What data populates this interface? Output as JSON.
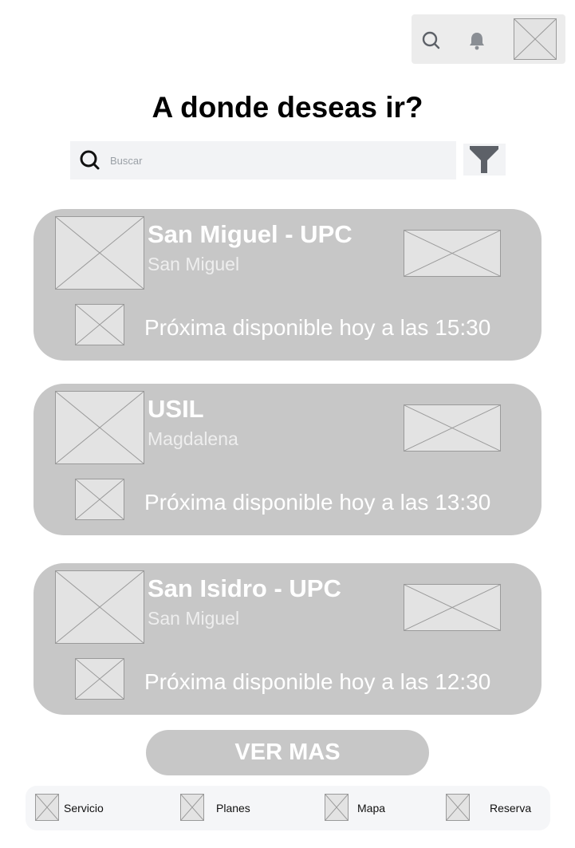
{
  "header": {
    "title": "A donde deseas ir?",
    "icons": [
      "search-icon",
      "bell-icon"
    ]
  },
  "search": {
    "placeholder": "Buscar",
    "value": ""
  },
  "cards": [
    {
      "name": "San Miguel - UPC",
      "location": "San Miguel",
      "next": "Próxima disponible hoy a las 15:30"
    },
    {
      "name": "USIL",
      "location": "Magdalena",
      "next": "Próxima disponible hoy a las 13:30"
    },
    {
      "name": "San Isidro - UPC",
      "location": "San Miguel",
      "next": "Próxima disponible hoy a las 12:30"
    }
  ],
  "more_label": "VER MAS",
  "nav": {
    "items": [
      {
        "label": "Servicio"
      },
      {
        "label": "Planes"
      },
      {
        "label": "Mapa"
      },
      {
        "label": "Reserva"
      }
    ]
  },
  "colors": {
    "card": "#c7c7c7",
    "topbar": "#ececec",
    "search_bg": "#f2f3f5",
    "placeholder_fill": "#e3e3e3",
    "filter_icon": "#5d6168",
    "text_light": "#ffffff"
  }
}
